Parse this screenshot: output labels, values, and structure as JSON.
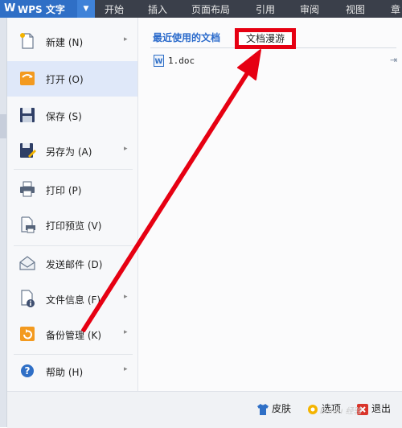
{
  "app": {
    "logo_mark": "W",
    "title": "WPS 文字",
    "dropdown": "▼"
  },
  "top_menu": [
    {
      "label": "开始"
    },
    {
      "label": "插入"
    },
    {
      "label": "页面布局"
    },
    {
      "label": "引用"
    },
    {
      "label": "审阅"
    },
    {
      "label": "视图"
    },
    {
      "label": "章"
    }
  ],
  "sidebar": {
    "items": [
      {
        "label": "新建 (N)",
        "icon": "new-document-icon",
        "has_submenu": true
      },
      {
        "label": "打开 (O)",
        "icon": "open-folder-icon",
        "has_submenu": false,
        "active": true
      },
      {
        "label": "保存 (S)",
        "icon": "save-floppy-icon",
        "has_submenu": false
      },
      {
        "label": "另存为 (A)",
        "icon": "save-as-icon",
        "has_submenu": true
      },
      {
        "label": "打印 (P)",
        "icon": "printer-icon",
        "has_submenu": false
      },
      {
        "label": "打印预览 (V)",
        "icon": "print-preview-icon",
        "has_submenu": false
      },
      {
        "label": "发送邮件 (D)",
        "icon": "envelope-icon",
        "has_submenu": false
      },
      {
        "label": "文件信息 (F)",
        "icon": "file-info-icon",
        "has_submenu": true
      },
      {
        "label": "备份管理 (K)",
        "icon": "backup-icon",
        "has_submenu": true
      },
      {
        "label": "帮助 (H)",
        "icon": "help-icon",
        "has_submenu": true
      }
    ],
    "arrow": "▸"
  },
  "tabs": {
    "recent": "最近使用的文档",
    "roaming": "文档漫游"
  },
  "recent_files": [
    {
      "name": "1.doc",
      "pin": "⇥"
    }
  ],
  "bottom_bar": {
    "skin": "皮肤",
    "options": "选项",
    "exit": "退出"
  },
  "watermark": "Baidu 经验",
  "colors": {
    "accent_blue": "#2a6acb",
    "annotation_red": "#e60012",
    "active_item": "#dfe8f9"
  }
}
